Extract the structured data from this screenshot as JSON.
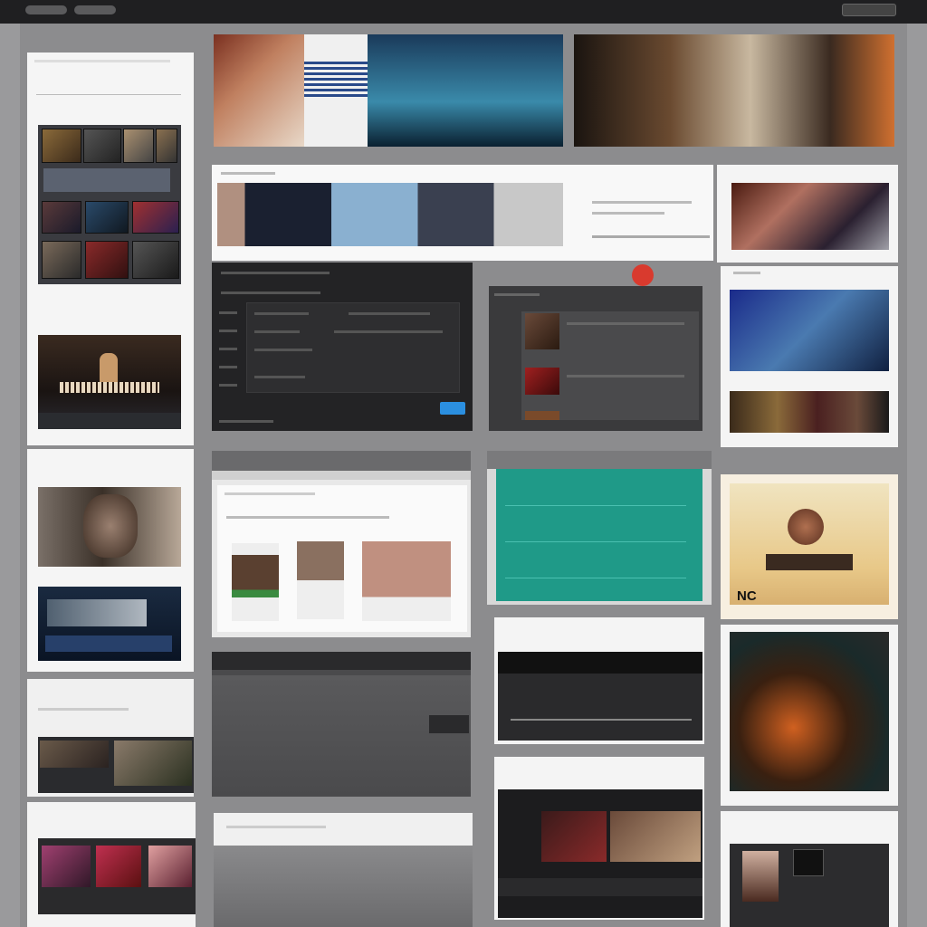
{
  "topbar": {
    "pill1": "",
    "pill2": "",
    "nav1": "",
    "nav2": "",
    "nav3": "",
    "nav4": "",
    "nav5": "",
    "right_button": ""
  },
  "sidebar": {
    "section1_title": "",
    "section1_subtitle": "",
    "section2_title": "",
    "section3_title": "",
    "section3_caption": "",
    "section4_title": "",
    "section5_title": ""
  },
  "center": {
    "cta_button": "",
    "bottom_card_title": "",
    "card_heading": ""
  },
  "right": {
    "card1_title": "",
    "card3_caption": "",
    "card4_big": "NC",
    "card4_caption": "",
    "card5_title": ""
  },
  "colors": {
    "accent_blue": "#2b8fe0",
    "accent_teal": "#1f9a88",
    "accent_red": "#d93a2e",
    "background": "#9a9a9c"
  }
}
